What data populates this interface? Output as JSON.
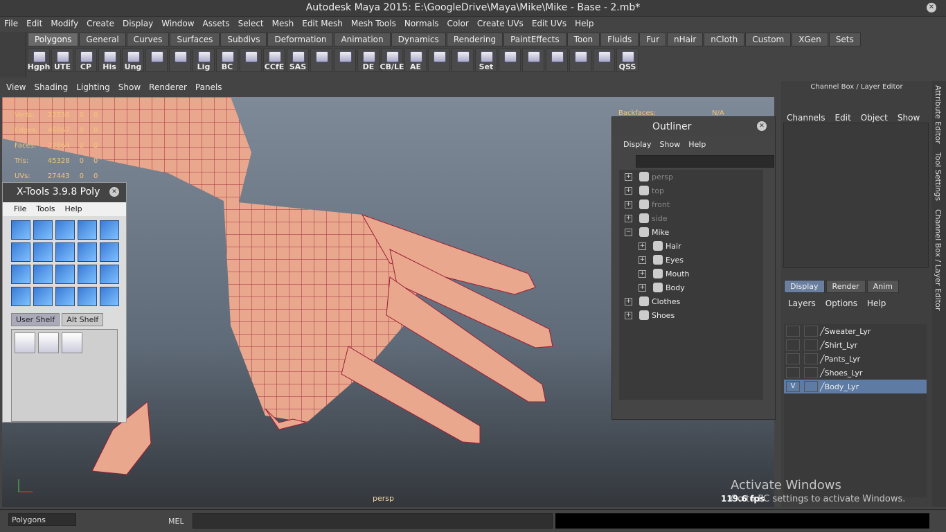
{
  "window": {
    "title": "Autodesk Maya 2015: E:\\GoogleDrive\\Maya\\Mike\\Mike - Base - 2.mb*"
  },
  "menubar": [
    "File",
    "Edit",
    "Modify",
    "Create",
    "Display",
    "Window",
    "Assets",
    "Select",
    "Mesh",
    "Edit Mesh",
    "Mesh Tools",
    "Normals",
    "Color",
    "Create UVs",
    "Edit UVs",
    "Help"
  ],
  "shelf_tabs": [
    "Polygons",
    "General",
    "Curves",
    "Surfaces",
    "Subdivs",
    "Deformation",
    "Animation",
    "Dynamics",
    "Rendering",
    "PaintEffects",
    "Toon",
    "Fluids",
    "Fur",
    "nHair",
    "nCloth",
    "Custom",
    "XGen",
    "Sets"
  ],
  "shelf_buttons": [
    "Hgph",
    "UTE",
    "CP",
    "His",
    "Ung",
    "",
    "",
    "Lig",
    "BC",
    "",
    "CCfE",
    "SAS",
    "",
    "",
    "DE",
    "CB/LE",
    "AE",
    "",
    "",
    "Set",
    "",
    "",
    "",
    "",
    "",
    "QSS"
  ],
  "viewport_menu": [
    "View",
    "Shading",
    "Lighting",
    "Show",
    "Renderer",
    "Panels"
  ],
  "hud": {
    "rows": [
      {
        "label": "Verts:",
        "v1": "22536",
        "v2": "0",
        "v3": "0"
      },
      {
        "label": "Edges:",
        "v1": "46067",
        "v2": "0",
        "v3": "0"
      },
      {
        "label": "Faces:",
        "v1": "22664",
        "v2": "0",
        "v3": "0"
      },
      {
        "label": "Tris:",
        "v1": "45328",
        "v2": "0",
        "v3": "0"
      },
      {
        "label": "UVs:",
        "v1": "27443",
        "v2": "0",
        "v3": "0"
      }
    ],
    "backfaces_label": "Backfaces:",
    "backfaces_value": "N/A",
    "camera": "persp",
    "fps": "119.6 fps"
  },
  "xtools": {
    "title": "X-Tools 3.9.8 Poly",
    "menu": [
      "File",
      "Tools",
      "Help"
    ],
    "shelf_tabs": [
      "User Shelf",
      "Alt Shelf"
    ]
  },
  "outliner": {
    "title": "Outliner",
    "menu": [
      "Display",
      "Show",
      "Help"
    ],
    "items": [
      {
        "label": "persp",
        "level": 0,
        "dim": true
      },
      {
        "label": "top",
        "level": 0,
        "dim": true
      },
      {
        "label": "front",
        "level": 0,
        "dim": true
      },
      {
        "label": "side",
        "level": 0,
        "dim": true
      },
      {
        "label": "Mike",
        "level": 0,
        "dim": false,
        "expanded": true
      },
      {
        "label": "Hair",
        "level": 1,
        "dim": false
      },
      {
        "label": "Eyes",
        "level": 1,
        "dim": false
      },
      {
        "label": "Mouth",
        "level": 1,
        "dim": false
      },
      {
        "label": "Body",
        "level": 1,
        "dim": false
      },
      {
        "label": "Clothes",
        "level": 0,
        "dim": false
      },
      {
        "label": "Shoes",
        "level": 0,
        "dim": false
      }
    ]
  },
  "channel_box": {
    "title": "Channel Box / Layer Editor",
    "menu": [
      "Channels",
      "Edit",
      "Object",
      "Show"
    ]
  },
  "layer_editor": {
    "tabs": [
      "Display",
      "Render",
      "Anim"
    ],
    "menu": [
      "Layers",
      "Options",
      "Help"
    ],
    "layers": [
      {
        "name": "Sweater_Lyr",
        "visible": "",
        "selected": false
      },
      {
        "name": "Shirt_Lyr",
        "visible": "",
        "selected": false
      },
      {
        "name": "Pants_Lyr",
        "visible": "",
        "selected": false
      },
      {
        "name": "Shoes_Lyr",
        "visible": "",
        "selected": false
      },
      {
        "name": "Body_Lyr",
        "visible": "V",
        "selected": true
      }
    ]
  },
  "side_tabs": [
    "Attribute Editor",
    "Tool Settings",
    "Channel Box / Layer Editor"
  ],
  "bottom": {
    "mode": "Polygons",
    "cmd_label": "MEL"
  },
  "watermark": {
    "line1": "Activate Windows",
    "line2": "Go to PC settings to activate Windows."
  },
  "colors": {
    "wire": "#9b1c35",
    "skin": "#e9a78d",
    "selected_layer": "#5d7ba3"
  }
}
